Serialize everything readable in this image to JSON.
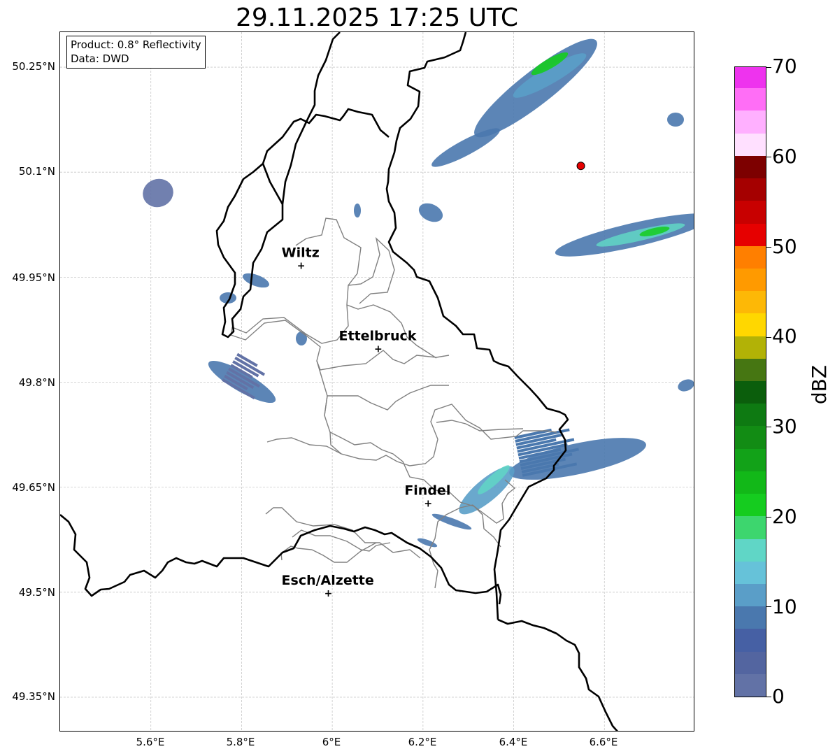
{
  "title": "29.11.2025 17:25 UTC",
  "info": {
    "product": "Product: 0.8° Reflectivity",
    "source": "Data: DWD"
  },
  "lat_labels": [
    "50.25°N",
    "50.1°N",
    "49.95°N",
    "49.8°N",
    "49.65°N",
    "49.5°N",
    "49.35°N"
  ],
  "lon_labels": [
    "5.6°E",
    "5.8°E",
    "6°E",
    "6.2°E",
    "6.4°E",
    "6.6°E"
  ],
  "map_bounds": {
    "lon": [
      5.4,
      6.8
    ],
    "lat": [
      49.3,
      50.3
    ]
  },
  "cities": [
    {
      "name": "Wiltz",
      "lon": 5.93,
      "lat": 49.967
    },
    {
      "name": "Ettelbruck",
      "lon": 6.1,
      "lat": 49.848
    },
    {
      "name": "Findel",
      "lon": 6.21,
      "lat": 49.627
    },
    {
      "name": "Esch/Alzette",
      "lon": 5.99,
      "lat": 49.499
    }
  ],
  "radar_site": {
    "lon": 6.548,
    "lat": 50.109,
    "color": "#e60000"
  },
  "colorbar": {
    "label": "dBZ",
    "min": 0,
    "max": 70,
    "ticks": [
      "0",
      "10",
      "20",
      "30",
      "40",
      "50",
      "60",
      "70"
    ],
    "colors": [
      "#6272a6",
      "#5365a0",
      "#4660a4",
      "#4a78ae",
      "#5a9ec8",
      "#66c2d9",
      "#60d6c6",
      "#3dd66e",
      "#15cc1f",
      "#12b818",
      "#12a218",
      "#128c14",
      "#0e7a12",
      "#0b5e0c",
      "#467612",
      "#b2b206",
      "#ffd700",
      "#fdb806",
      "#ff9a00",
      "#ff7f00",
      "#e60000",
      "#c80000",
      "#a50000",
      "#7d0000",
      "#ffe0ff",
      "#ffb0ff",
      "#ff6ef6",
      "#ee33ee"
    ]
  },
  "reflectivity_colors": {
    "light": "#6272a6",
    "low": "#4a78ae",
    "mid": "#5a9ec8",
    "cyan": "#60d6c6",
    "green": "#15cc1f",
    "lime": "#3dd66e"
  }
}
